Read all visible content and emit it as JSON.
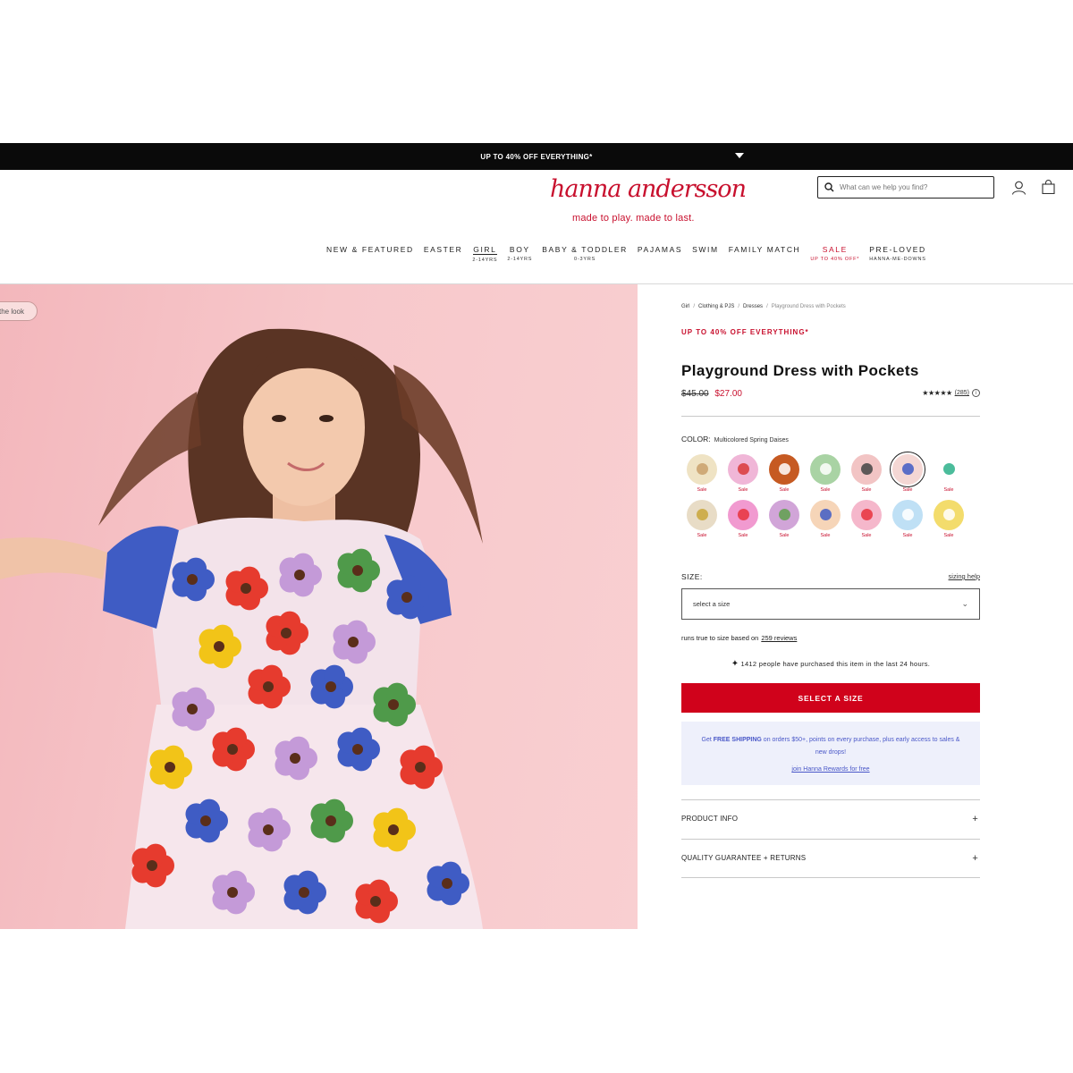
{
  "promo_bar": {
    "text": "UP TO 40% OFF EVERYTHING*"
  },
  "brand": {
    "wordmark": "hanna andersson",
    "tagline": "made to play. made to last."
  },
  "search": {
    "placeholder": "What can we help you find?"
  },
  "nav": [
    {
      "label": "NEW & FEATURED",
      "sub": ""
    },
    {
      "label": "EASTER",
      "sub": ""
    },
    {
      "label": "GIRL",
      "sub": "2-14YRS",
      "active": true
    },
    {
      "label": "BOY",
      "sub": "2-14YRS"
    },
    {
      "label": "BABY & TODDLER",
      "sub": "0-3YRS"
    },
    {
      "label": "PAJAMAS",
      "sub": ""
    },
    {
      "label": "SWIM",
      "sub": ""
    },
    {
      "label": "FAMILY MATCH",
      "sub": ""
    },
    {
      "label": "SALE",
      "sub": "UP TO 40% OFF*",
      "sale": true
    },
    {
      "label": "PRE-LOVED",
      "sub": "HANNA-ME-DOWNS"
    }
  ],
  "hero": {
    "shop_look_label": "the look"
  },
  "breadcrumb": [
    "Girl",
    "Clothing & PJS",
    "Dresses",
    "Playground Dress with Pockets"
  ],
  "product": {
    "promo": "UP TO 40% OFF EVERYTHING*",
    "title": "Playground Dress with Pockets",
    "original_price": "$45.00",
    "sale_price": "$27.00",
    "rating_stars": "★★★★★",
    "review_count": "(285)",
    "rating_info": "i"
  },
  "color": {
    "label": "COLOR:",
    "selected": "Multicolored Spring Daises",
    "swatches": [
      {
        "name": "cream-floral",
        "sale": "Sale",
        "bg": "#efe3c4"
      },
      {
        "name": "pink-apple",
        "sale": "Sale",
        "bg": "#f0b6d7"
      },
      {
        "name": "rust-carousel",
        "sale": "Sale",
        "bg": "#c65a22"
      },
      {
        "name": "sage-horse",
        "sale": "Sale",
        "bg": "#a9d3a4"
      },
      {
        "name": "pink-cat",
        "sale": "Sale",
        "bg": "#f2c4c4"
      },
      {
        "name": "spring-daises",
        "sale": "Sale",
        "bg": "#f4d7d4",
        "selected": true
      },
      {
        "name": "green-clover",
        "sale": "Sale",
        "bg": "#ffffff"
      },
      {
        "name": "cream-tulip",
        "sale": "Sale",
        "bg": "#e8dcc6"
      },
      {
        "name": "pink-red-abstract",
        "sale": "Sale",
        "bg": "#f19ad0"
      },
      {
        "name": "lilac-frog",
        "sale": "Sale",
        "bg": "#d1a5d8"
      },
      {
        "name": "rainbow-wave",
        "sale": "Sale",
        "bg": "#f6d5b8"
      },
      {
        "name": "pink-strawberry",
        "sale": "Sale",
        "bg": "#f5b7cb"
      },
      {
        "name": "blue-cloud",
        "sale": "Sale",
        "bg": "#bfe0f5"
      },
      {
        "name": "yellow-floral",
        "sale": "Sale",
        "bg": "#f3dc6c"
      }
    ]
  },
  "size": {
    "label": "SIZE:",
    "help": "sizing help",
    "select_placeholder": "select a size",
    "fit_note": "runs true to size based on",
    "fit_link": "259 reviews"
  },
  "social_proof": {
    "text": "1412 people have purchased this item in the last 24 hours."
  },
  "cta": {
    "label": "SELECT A SIZE"
  },
  "rewards": {
    "text_prefix": "Get ",
    "text_bold": "FREE SHIPPING",
    "text_suffix": " on orders $50+, points on every purchase, plus early access to sales & new drops!",
    "link": "join Hanna Rewards for free"
  },
  "accordions": [
    {
      "label": "PRODUCT INFO"
    },
    {
      "label": "QUALITY GUARANTEE + RETURNS"
    }
  ],
  "colors": {
    "brand_red": "#c8102e",
    "cta_red": "#d0021b",
    "rewards_bg": "#eef0fb",
    "rewards_text": "#4a58c8"
  }
}
